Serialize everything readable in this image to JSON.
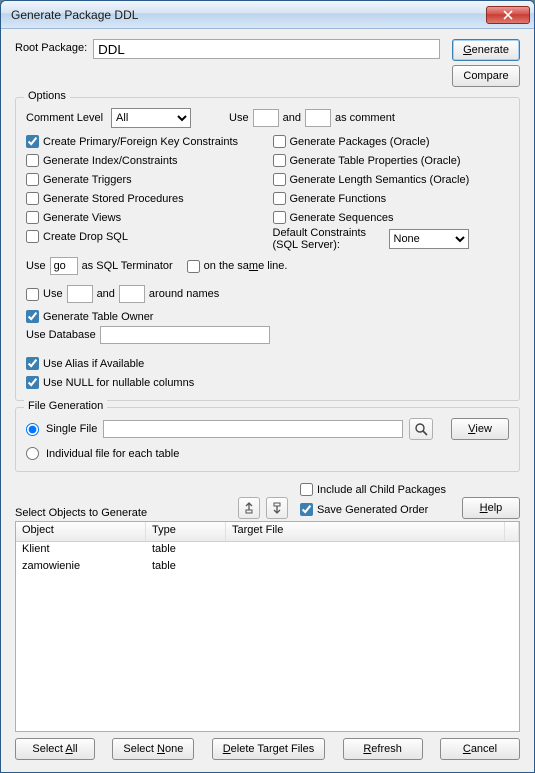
{
  "window": {
    "title": "Generate Package DDL"
  },
  "buttons": {
    "generate": "Generate",
    "compare": "Compare",
    "view": "View",
    "help": "Help",
    "select_all": "Select All",
    "select_none": "Select None",
    "delete_target": "Delete Target Files",
    "refresh": "Refresh",
    "cancel": "Cancel"
  },
  "root": {
    "label": "Root Package:",
    "value": "DDL"
  },
  "options": {
    "title": "Options",
    "comment_level_label": "Comment Level",
    "comment_level_value": "All",
    "use_label": "Use",
    "and_label": "and",
    "as_comment": "as comment",
    "comment_prefix": "",
    "comment_suffix": "",
    "left": [
      {
        "label": "Create Primary/Foreign Key Constraints",
        "checked": true
      },
      {
        "label": "Generate Index/Constraints",
        "checked": false
      },
      {
        "label": "Generate Triggers",
        "checked": false
      },
      {
        "label": "Generate Stored Procedures",
        "checked": false
      },
      {
        "label": "Generate Views",
        "checked": false
      },
      {
        "label": "Create Drop SQL",
        "checked": false
      }
    ],
    "right": [
      {
        "label": "Generate Packages (Oracle)",
        "checked": false
      },
      {
        "label": "Generate Table Properties (Oracle)",
        "checked": false
      },
      {
        "label": "Generate Length Semantics (Oracle)",
        "checked": false
      },
      {
        "label": "Generate Functions",
        "checked": false
      },
      {
        "label": "Generate Sequences",
        "checked": false
      }
    ],
    "default_constraints_label": "Default Constraints (SQL Server):",
    "default_constraints_value": "None",
    "terminator": {
      "use": "Use",
      "value": "go",
      "suffix": "as SQL Terminator",
      "same_line_label": "on the same line.",
      "same_line_checked": false
    },
    "around_names": {
      "use": "Use",
      "and": "and",
      "suffix": "around names",
      "checked": false,
      "v1": "",
      "v2": ""
    },
    "gen_table_owner": {
      "label": "Generate Table Owner",
      "checked": true
    },
    "use_db": {
      "label": "Use Database",
      "value": ""
    },
    "alias": {
      "label": "Use Alias if Available",
      "checked": true
    },
    "null_cols": {
      "label": "Use NULL for nullable columns",
      "checked": true
    }
  },
  "filegen": {
    "title": "File Generation",
    "single": "Single File",
    "individual": "Individual file for each table",
    "path": ""
  },
  "objects": {
    "select_label": "Select Objects to Generate",
    "include_child": {
      "label": "Include all Child Packages",
      "checked": false
    },
    "save_order": {
      "label": "Save Generated Order",
      "checked": true
    },
    "headers": {
      "object": "Object",
      "type": "Type",
      "target": "Target File"
    },
    "rows": [
      {
        "object": "Klient",
        "type": "table",
        "target": ""
      },
      {
        "object": "zamowienie",
        "type": "table",
        "target": ""
      }
    ]
  }
}
